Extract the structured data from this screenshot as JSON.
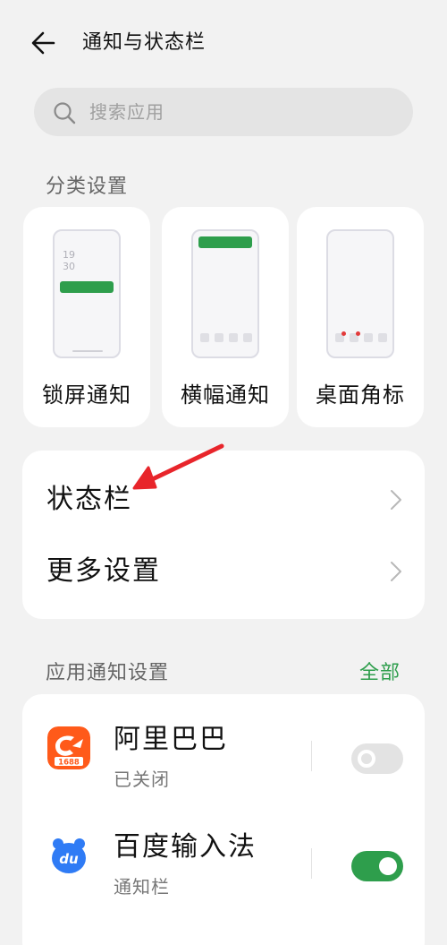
{
  "header": {
    "title": "通知与状态栏",
    "back_icon": "arrow-left-icon"
  },
  "search": {
    "placeholder": "搜索应用",
    "icon": "search-icon"
  },
  "category_section": {
    "title": "分类设置",
    "cards": [
      {
        "label": "锁屏通知",
        "preview_time": [
          "19",
          "30"
        ],
        "accent": "#2e9e4c"
      },
      {
        "label": "横幅通知",
        "accent": "#2e9e4c"
      },
      {
        "label": "桌面角标",
        "badge_color": "#e23a3a"
      }
    ]
  },
  "settings_list": {
    "items": [
      {
        "label": "状态栏",
        "chevron_icon": "chevron-right-icon"
      },
      {
        "label": "更多设置",
        "chevron_icon": "chevron-right-icon"
      }
    ],
    "annotation": {
      "type": "arrow",
      "color": "#e8252b"
    }
  },
  "app_section": {
    "title": "应用通知设置",
    "view_all_label": "全部",
    "apps": [
      {
        "name": "阿里巴巴",
        "status": "已关闭",
        "toggle_on": false,
        "icon": "alibaba-app-icon",
        "icon_color": "#ff5a1a",
        "icon_text": "1688"
      },
      {
        "name": "百度输入法",
        "status": "通知栏",
        "toggle_on": true,
        "icon": "baidu-input-app-icon",
        "icon_color": "#2f7bf5",
        "icon_text": "du"
      }
    ]
  },
  "theme": {
    "accent": "#2e9e4c",
    "background": "#f2f2f2",
    "card": "#ffffff"
  }
}
